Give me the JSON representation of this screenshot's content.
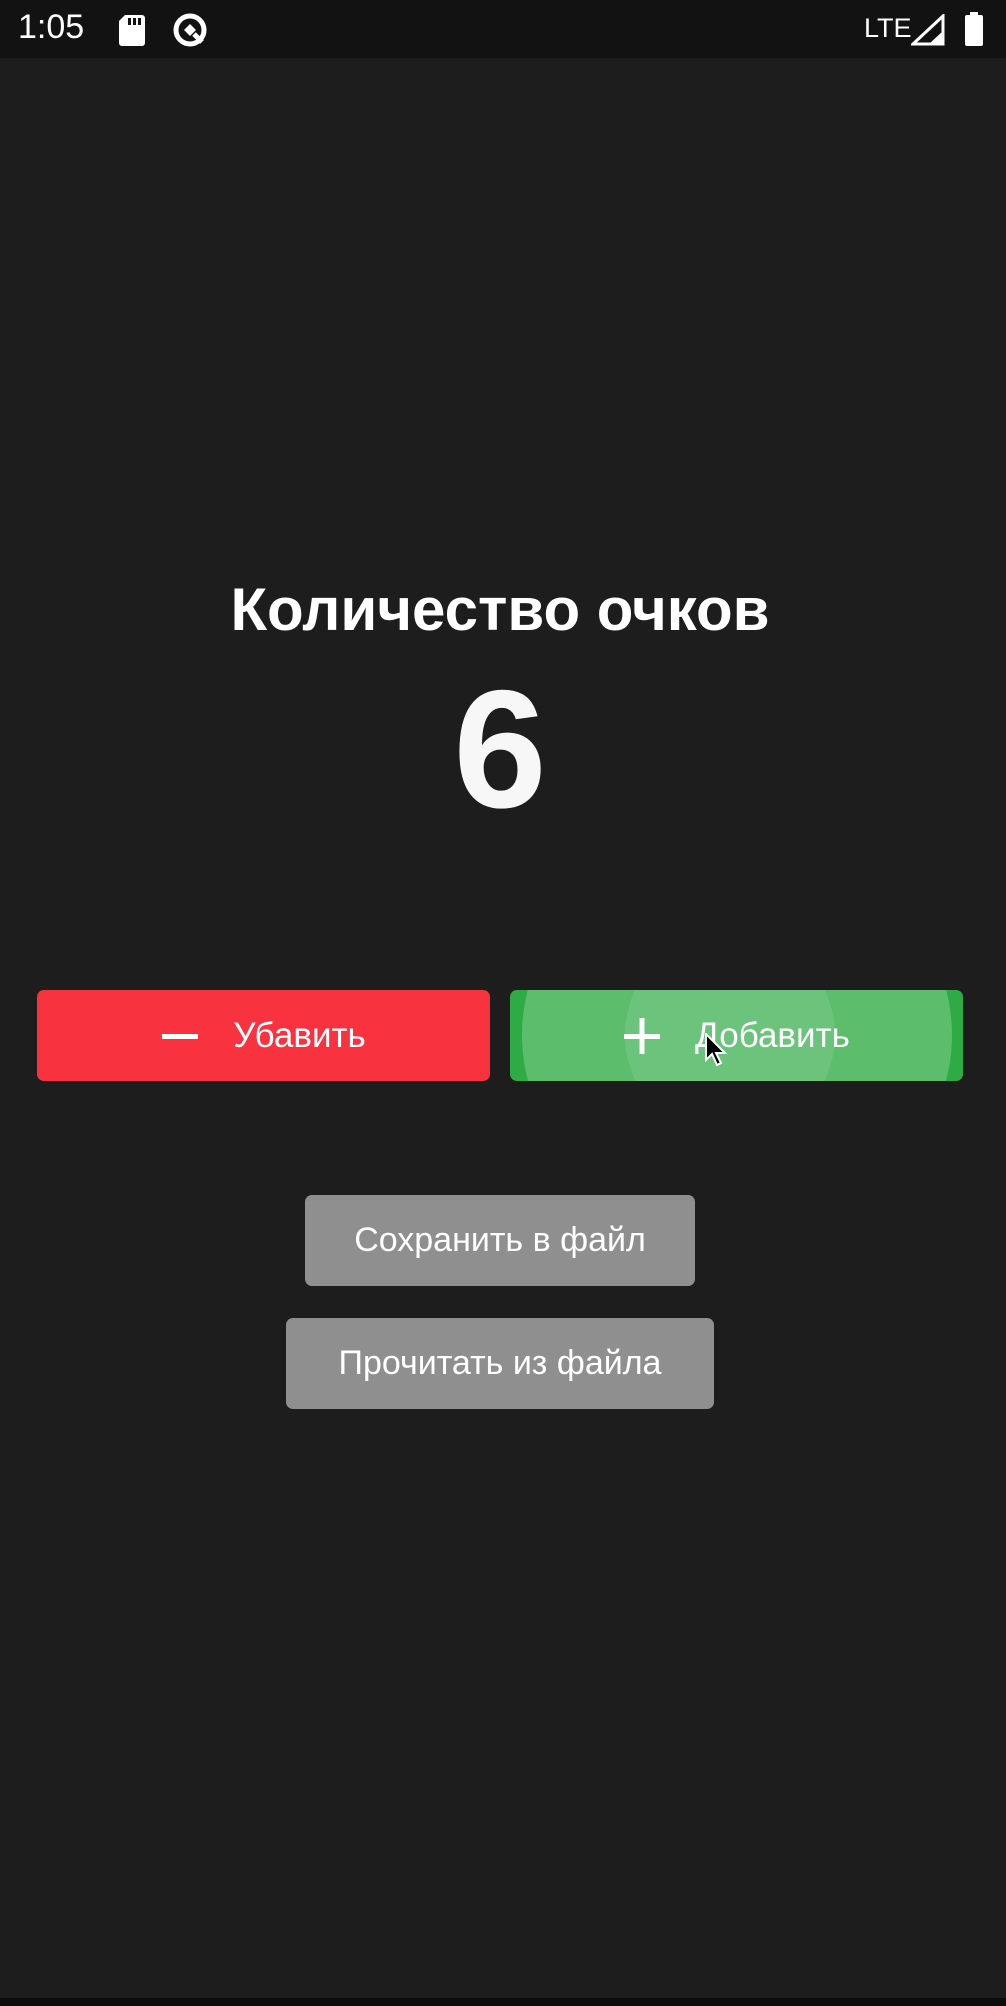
{
  "status_bar": {
    "time": "1:05",
    "network": "LTE",
    "icons": [
      "sd-card-icon",
      "sync-icon",
      "signal-icon",
      "battery-icon"
    ]
  },
  "main": {
    "title": "Количество очков",
    "score": "6"
  },
  "buttons": {
    "subtract_label": "Убавить",
    "add_label": "Добавить",
    "save_label": "Сохранить в файл",
    "load_label": "Прочитать из файла"
  },
  "colors": {
    "background": "#1d1d1d",
    "subtract": "#f8323f",
    "add": "#2fab45",
    "secondary": "#8f8f8f"
  }
}
